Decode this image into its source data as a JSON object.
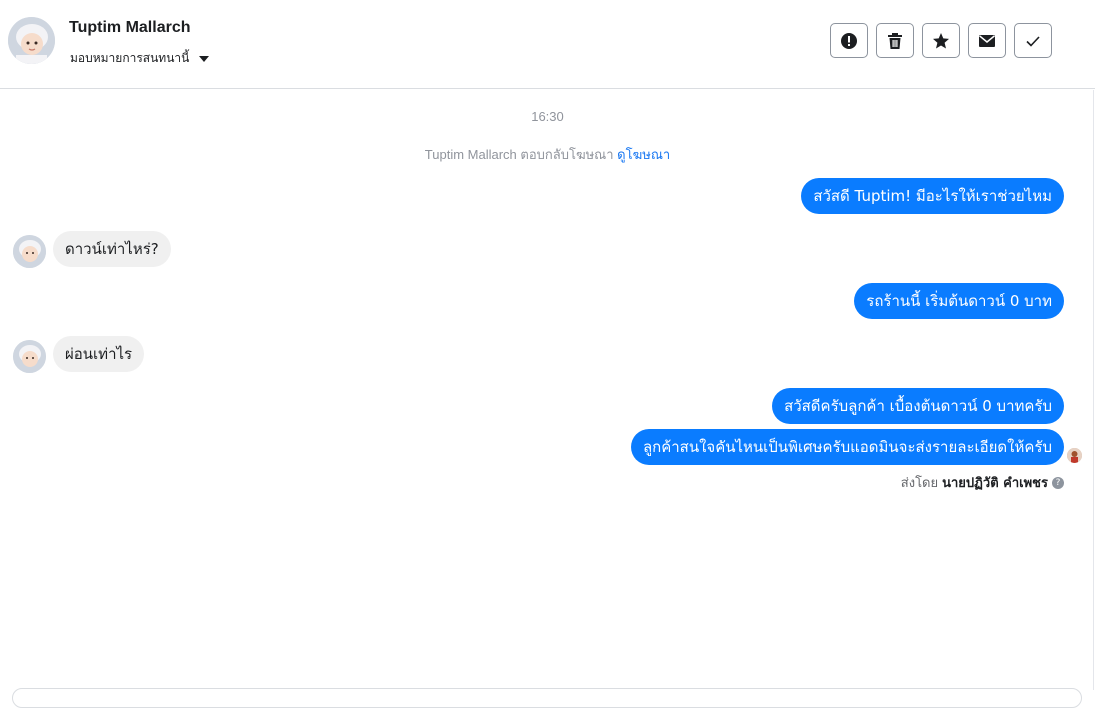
{
  "header": {
    "contact_name": "Tuptim Mallarch",
    "assign_label": "มอบหมายการสนทนานี้",
    "actions": [
      {
        "icon": "alert-icon"
      },
      {
        "icon": "trash-icon"
      },
      {
        "icon": "star-icon"
      },
      {
        "icon": "envelope-icon"
      },
      {
        "icon": "check-icon"
      }
    ]
  },
  "conversation": {
    "timestamp": "16:30",
    "ad_reply_text": "Tuptim Mallarch ตอบกลับโฆษณา",
    "ad_reply_link": "ดูโฆษณา",
    "messages": [
      {
        "direction": "outgoing",
        "text": "สวัสดี Tuptim! มีอะไรให้เราช่วยไหม"
      },
      {
        "direction": "incoming",
        "text": "ดาวน์เท่าไหร่?"
      },
      {
        "direction": "outgoing",
        "text": "รถร้านนี้ เริ่มต้นดาวน์ 0 บาท"
      },
      {
        "direction": "incoming",
        "text": "ผ่อนเท่าไร"
      },
      {
        "direction": "outgoing",
        "text": "สวัสดีครับลูกค้า เบื้องต้นดาวน์ 0 บาทครับ"
      },
      {
        "direction": "outgoing",
        "text": "ลูกค้าสนใจคันไหนเป็นพิเศษครับแอดมินจะส่งรายละเอียดให้ครับ"
      }
    ],
    "sent_by_label": "ส่งโดย",
    "sent_by_name": "นายปฏิวัติ คำเพชร",
    "help_glyph": "?"
  },
  "colors": {
    "outgoing_bubble": "#0a7cff",
    "incoming_bubble": "#f0f0f0",
    "link": "#1877f2",
    "meta_text": "#90949c"
  }
}
